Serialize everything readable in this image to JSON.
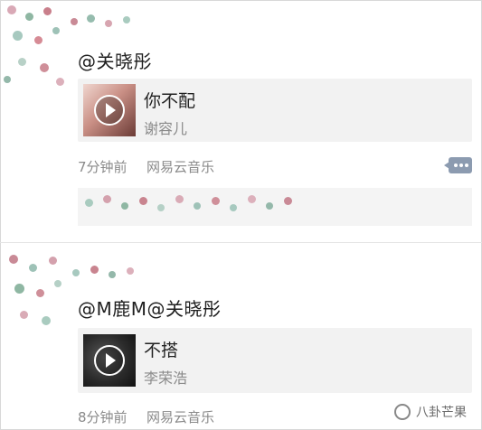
{
  "colors": {
    "background": "#ffffff",
    "card": "#f2f2f2",
    "meta_text": "#8a8a8a",
    "comment_icon": "#8c9bb0"
  },
  "posts": [
    {
      "mention": "@关晓彤",
      "song": {
        "title": "你不配",
        "artist": "谢容儿"
      },
      "time": "7分钟前",
      "source": "网易云音乐"
    },
    {
      "mention": "@M鹿M@关晓彤",
      "song": {
        "title": "不搭",
        "artist": "李荣浩"
      },
      "time": "8分钟前",
      "source": "网易云音乐"
    }
  ],
  "icons": {
    "play": "play-icon",
    "comment": "comment-icon",
    "watermark": "wechat-logo-icon"
  },
  "watermark": {
    "text": "八卦芒果"
  }
}
